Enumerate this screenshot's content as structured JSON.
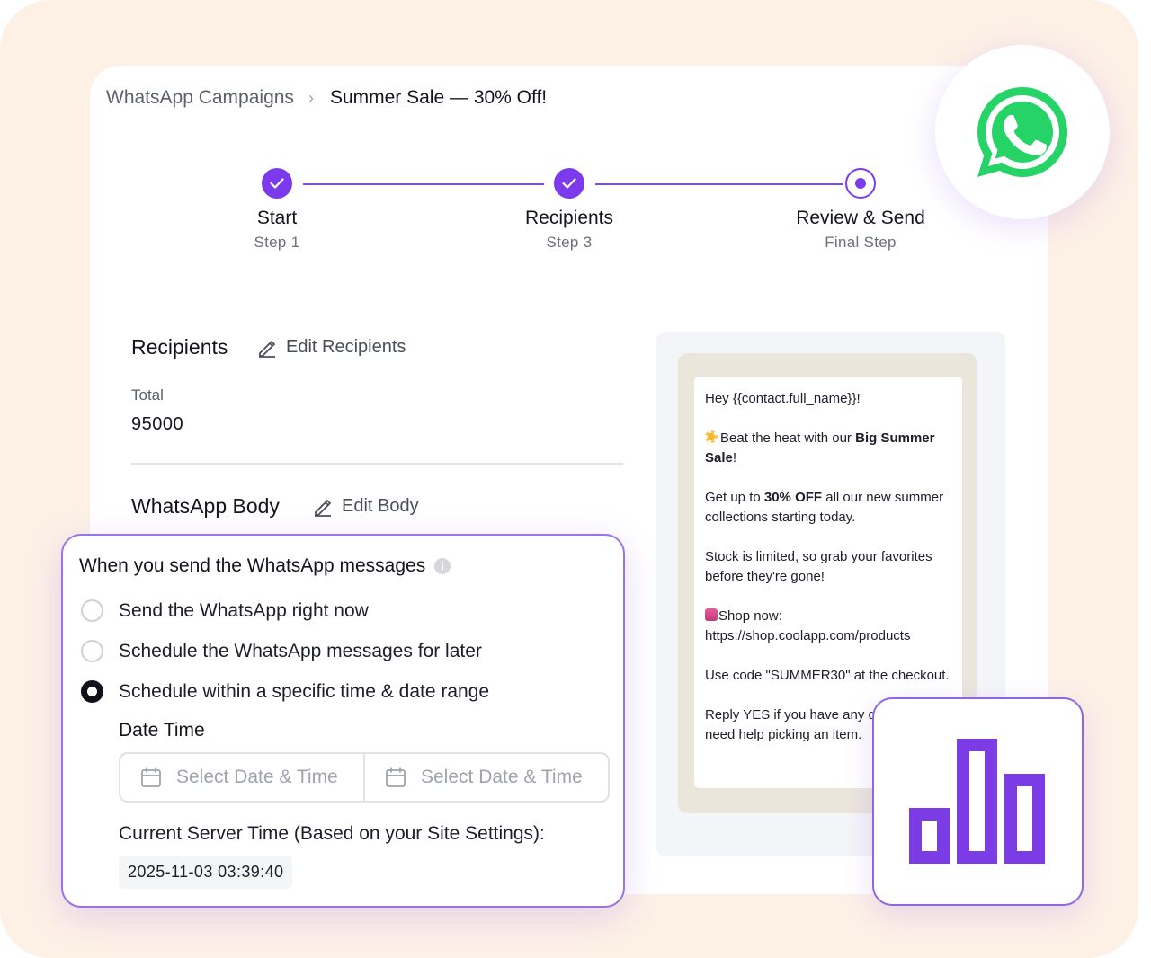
{
  "breadcrumb": {
    "root": "WhatsApp Campaigns",
    "current": "Summer Sale — 30% Off!"
  },
  "stepper": [
    {
      "label": "Start",
      "sub": "Step 1",
      "state": "done"
    },
    {
      "label": "Recipients",
      "sub": "Step 3",
      "state": "done"
    },
    {
      "label": "Review & Send",
      "sub": "Final Step",
      "state": "current"
    }
  ],
  "recipients": {
    "title": "Recipients",
    "edit_label": "Edit Recipients",
    "total_label": "Total",
    "total_value": "95000"
  },
  "body_section": {
    "title": "WhatsApp Body",
    "edit_label": "Edit Body"
  },
  "preview": {
    "greeting": "Hey {{contact.full_name}}!",
    "line1_pre": "Beat the heat with our ",
    "line1_bold": "Big Summer Sale",
    "line1_post": "!",
    "line2_pre": "Get up to ",
    "line2_bold": "30% OFF",
    "line2_post": " all our new summer collections starting today.",
    "line3": "Stock is limited, so grab your favorites before they're gone!",
    "line4_label": "Shop now:",
    "line4_url": "https://shop.coolapp.com/products",
    "line5": "Use code \"SUMMER30\" at the checkout.",
    "line6": "Reply YES if you have any questions or need help picking an item."
  },
  "schedule": {
    "title": "When you send the WhatsApp messages",
    "options": [
      "Send the WhatsApp right now",
      "Schedule the WhatsApp messages for later",
      "Schedule within a specific time & date range"
    ],
    "selected_index": 2,
    "date_time_label": "Date Time",
    "start_placeholder": "Select Date & Time",
    "end_placeholder": "Select Date & Time",
    "server_time_label": "Current Server Time (Based on your Site Settings):",
    "server_time": "2025-11-03 03:39:40"
  },
  "icons": {
    "whatsapp": "whatsapp-logo-icon",
    "chart": "bar-chart-icon",
    "calendar": "calendar-icon",
    "edit": "pencil-icon",
    "info": "info-icon"
  },
  "colors": {
    "accent": "#7c3aed",
    "whatsapp_green": "#25d366",
    "page_bg": "#fdf1e6"
  }
}
